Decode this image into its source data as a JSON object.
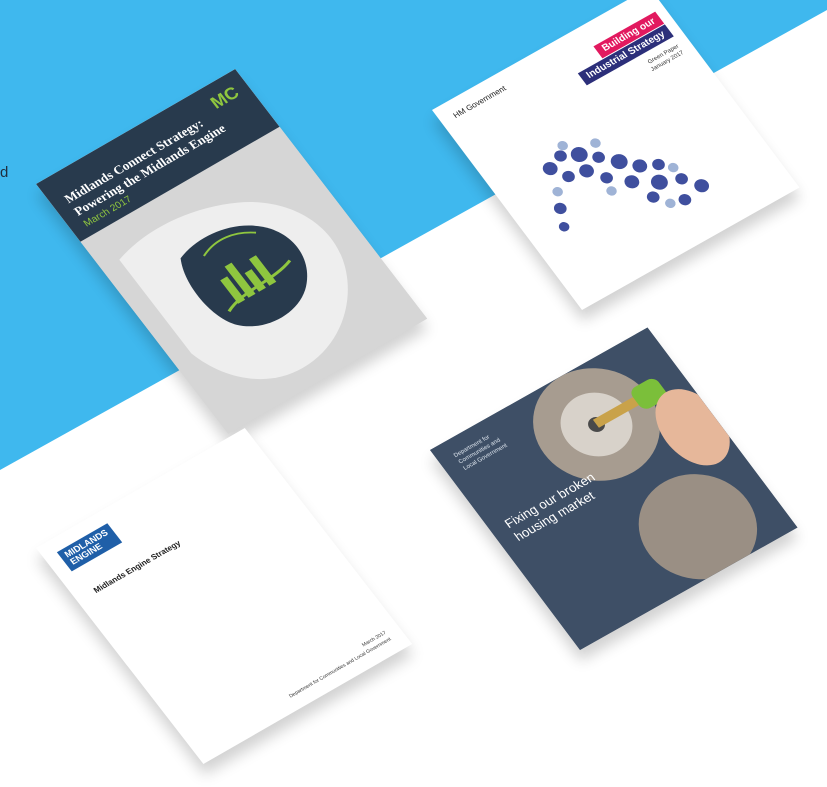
{
  "edge_text": "d",
  "colors": {
    "background_blue": "#3fb8ee",
    "page_white": "#ffffff",
    "mc_navy": "#283a4d",
    "mc_green": "#8fc63f",
    "is_pink": "#e2195f",
    "is_navy": "#2c2f7a",
    "me_blue": "#1f5fa8",
    "hm_slate": "#3e4f66"
  },
  "books": {
    "midlands_connect": {
      "logo": "MC",
      "title_line1": "Midlands Connect Strategy:",
      "title_line2": "Powering the Midlands Engine",
      "subtitle": "March 2017"
    },
    "industrial_strategy": {
      "publisher": "HM Government",
      "band_line1": "Building our",
      "band_line2": "Industrial Strategy",
      "meta_line1": "Green Paper",
      "meta_line2": "January 2017"
    },
    "midlands_engine": {
      "logo_line1": "MIDLANDS",
      "logo_line2": "ENGINE",
      "title": "Midlands Engine Strategy",
      "date": "March 2017",
      "department": "Department for Communities and Local Government"
    },
    "housing": {
      "dept_line1": "Department for",
      "dept_line2": "Communities and",
      "dept_line3": "Local Government",
      "title_line1": "Fixing our broken",
      "title_line2": "housing market"
    }
  }
}
